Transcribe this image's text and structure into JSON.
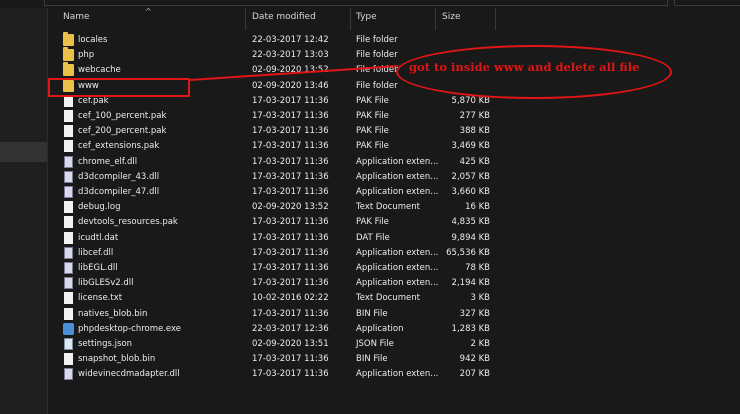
{
  "header": {
    "name": "Name",
    "date_modified": "Date modified",
    "type": "Type",
    "size": "Size",
    "sort_indicator": "^"
  },
  "files": [
    {
      "name": "locales",
      "date": "22-03-2017 12:42",
      "type": "File folder",
      "size": "",
      "icon": "folder-icon"
    },
    {
      "name": "php",
      "date": "22-03-2017 13:03",
      "type": "File folder",
      "size": "",
      "icon": "folder-icon"
    },
    {
      "name": "webcache",
      "date": "02-09-2020 13:52",
      "type": "File folder",
      "size": "",
      "icon": "folder-icon"
    },
    {
      "name": "www",
      "date": "02-09-2020 13:46",
      "type": "File folder",
      "size": "",
      "icon": "folder-icon"
    },
    {
      "name": "cef.pak",
      "date": "17-03-2017 11:36",
      "type": "PAK File",
      "size": "5,870 KB",
      "icon": "file-icon"
    },
    {
      "name": "cef_100_percent.pak",
      "date": "17-03-2017 11:36",
      "type": "PAK File",
      "size": "277 KB",
      "icon": "file-icon"
    },
    {
      "name": "cef_200_percent.pak",
      "date": "17-03-2017 11:36",
      "type": "PAK File",
      "size": "388 KB",
      "icon": "file-icon"
    },
    {
      "name": "cef_extensions.pak",
      "date": "17-03-2017 11:36",
      "type": "PAK File",
      "size": "3,469 KB",
      "icon": "file-icon"
    },
    {
      "name": "chrome_elf.dll",
      "date": "17-03-2017 11:36",
      "type": "Application exten...",
      "size": "425 KB",
      "icon": "dll-icon"
    },
    {
      "name": "d3dcompiler_43.dll",
      "date": "17-03-2017 11:36",
      "type": "Application exten...",
      "size": "2,057 KB",
      "icon": "dll-icon"
    },
    {
      "name": "d3dcompiler_47.dll",
      "date": "17-03-2017 11:36",
      "type": "Application exten...",
      "size": "3,660 KB",
      "icon": "dll-icon"
    },
    {
      "name": "debug.log",
      "date": "02-09-2020 13:52",
      "type": "Text Document",
      "size": "16 KB",
      "icon": "file-icon"
    },
    {
      "name": "devtools_resources.pak",
      "date": "17-03-2017 11:36",
      "type": "PAK File",
      "size": "4,835 KB",
      "icon": "file-icon"
    },
    {
      "name": "icudtl.dat",
      "date": "17-03-2017 11:36",
      "type": "DAT File",
      "size": "9,894 KB",
      "icon": "file-icon"
    },
    {
      "name": "libcef.dll",
      "date": "17-03-2017 11:36",
      "type": "Application exten...",
      "size": "65,536 KB",
      "icon": "dll-icon"
    },
    {
      "name": "libEGL.dll",
      "date": "17-03-2017 11:36",
      "type": "Application exten...",
      "size": "78 KB",
      "icon": "dll-icon"
    },
    {
      "name": "libGLESv2.dll",
      "date": "17-03-2017 11:36",
      "type": "Application exten...",
      "size": "2,194 KB",
      "icon": "dll-icon"
    },
    {
      "name": "license.txt",
      "date": "10-02-2016 02:22",
      "type": "Text Document",
      "size": "3 KB",
      "icon": "file-icon"
    },
    {
      "name": "natives_blob.bin",
      "date": "17-03-2017 11:36",
      "type": "BIN File",
      "size": "327 KB",
      "icon": "file-icon"
    },
    {
      "name": "phpdesktop-chrome.exe",
      "date": "22-03-2017 12:36",
      "type": "Application",
      "size": "1,283 KB",
      "icon": "exe-icon"
    },
    {
      "name": "settings.json",
      "date": "02-09-2020 13:51",
      "type": "JSON File",
      "size": "2 KB",
      "icon": "json-icon"
    },
    {
      "name": "snapshot_blob.bin",
      "date": "17-03-2017 11:36",
      "type": "BIN File",
      "size": "942 KB",
      "icon": "file-icon"
    },
    {
      "name": "widevinecdmadapter.dll",
      "date": "17-03-2017 11:36",
      "type": "Application exten...",
      "size": "207 KB",
      "icon": "dll-icon"
    }
  ],
  "annotation": {
    "text": "got to inside www and delete all file",
    "color": "#e01515"
  },
  "colors": {
    "background": "#191919",
    "folder": "#e8c04a",
    "annotation": "#e01515"
  }
}
